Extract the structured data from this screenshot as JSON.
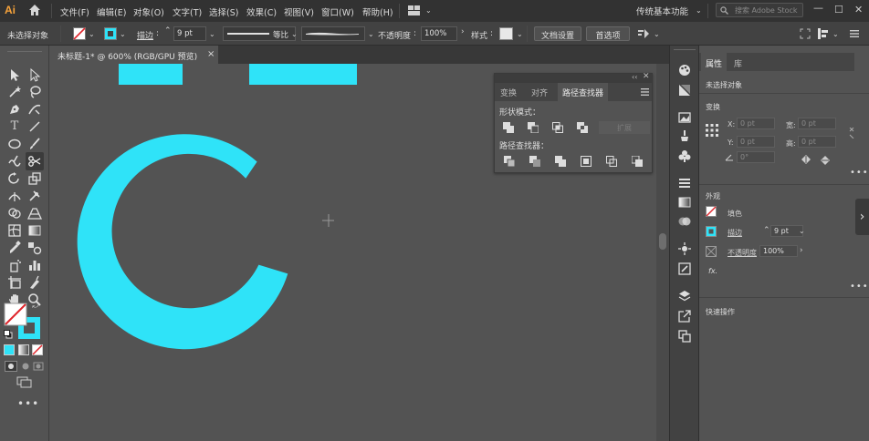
{
  "app": {
    "logo": "Ai"
  },
  "menu": {
    "items": [
      "文件(F)",
      "编辑(E)",
      "对象(O)",
      "文字(T)",
      "选择(S)",
      "效果(C)",
      "视图(V)",
      "窗口(W)",
      "帮助(H)"
    ],
    "workspace": "传统基本功能",
    "stock_placeholder": "搜索 Adobe Stock"
  },
  "control_bar": {
    "selection_status": "未选择对象",
    "stroke_label": "描边",
    "stroke_weight": "9 pt",
    "stroke_profile": "等比",
    "opacity_label": "不透明度",
    "opacity_value": "100%",
    "style_label": "样式",
    "doc_setup": "文档设置",
    "preferences": "首选项"
  },
  "document": {
    "tab_title": "未标题-1* @ 600% (RGB/GPU 预览)",
    "close": "×"
  },
  "pathfinder": {
    "tabs": [
      "变换",
      "对齐",
      "路径查找器"
    ],
    "active_tab": "路径查找器",
    "shape_modes_label": "形状模式：",
    "pathfinders_label": "路径查找器：",
    "expand_button": "扩展"
  },
  "properties": {
    "tabs": [
      "属性",
      "库"
    ],
    "active_tab": "属性",
    "selection_status": "未选择对象",
    "transform_label": "变换",
    "x_label": "X:",
    "y_label": "Y:",
    "w_label": "宽:",
    "h_label": "高:",
    "x_value": "0 pt",
    "y_value": "0 pt",
    "w_value": "0 pt",
    "h_value": "0 pt",
    "angle_value": "0°",
    "appearance_label": "外观",
    "fill_label": "填色",
    "stroke_label": "描边",
    "stroke_weight": "9 pt",
    "opacity_label": "不透明度",
    "opacity_value": "100%",
    "fx_label": "fx.",
    "quick_actions_label": "快速操作"
  },
  "colors": {
    "accent_cyan": "#2fe3f8",
    "canvas_bg": "#535353",
    "menubar_bg": "#323232",
    "ai_orange": "#f7a33b"
  }
}
